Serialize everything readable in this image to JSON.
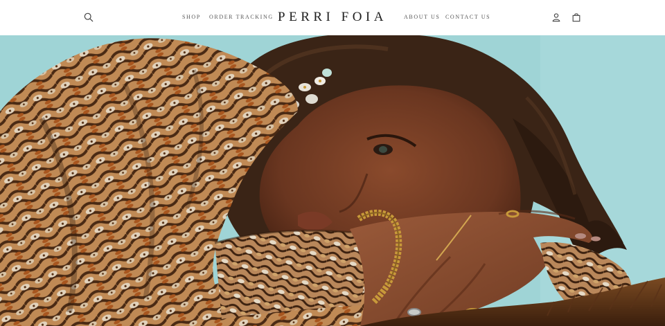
{
  "header": {
    "brand": "PERRI FOIA",
    "nav_left": [
      {
        "label": "SHOP"
      },
      {
        "label": "ORDER TRACKING"
      }
    ],
    "nav_right": [
      {
        "label": "ABOUT US"
      },
      {
        "label": "CONTACT US"
      }
    ],
    "icons": {
      "search": "search-icon",
      "account": "user-icon",
      "cart": "shopping-bag-icon"
    }
  },
  "hero": {
    "image": "fashion-model-snakeskin-blouse-hero-image",
    "colors": {
      "sky": "#9fd4d6",
      "hair": "#3a2416",
      "skin": "#6e3a22",
      "snakeskin_light": "#d9c9b3",
      "snakeskin_dark": "#5a3418",
      "snakeskin_rust": "#b5672b",
      "gold": "#c89a3a"
    }
  }
}
